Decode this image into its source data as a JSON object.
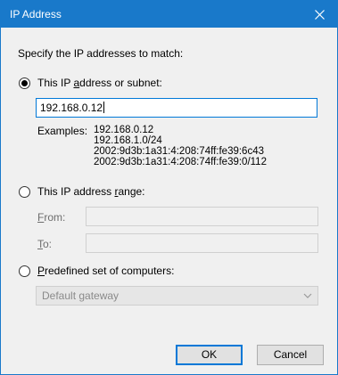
{
  "window": {
    "title": "IP Address"
  },
  "prompt": "Specify the IP addresses to match:",
  "option_subnet": {
    "label_before": "This IP ",
    "label_key": "a",
    "label_after": "ddress or subnet:",
    "selected": true,
    "value": "192.168.0.12"
  },
  "examples": {
    "label": "Examples:",
    "items": [
      "192.168.0.12",
      "192.168.1.0/24",
      "2002:9d3b:1a31:4:208:74ff:fe39:6c43",
      "2002:9d3b:1a31:4:208:74ff:fe39:0/112"
    ]
  },
  "option_range": {
    "label_before": "This IP address ",
    "label_key": "r",
    "label_after": "ange:",
    "selected": false,
    "from_key": "F",
    "from_rest": "rom:",
    "to_key": "T",
    "to_rest": "o:",
    "from_value": "",
    "to_value": ""
  },
  "option_predefined": {
    "label_key": "P",
    "label_after": "redefined set of computers:",
    "selected": false,
    "dropdown_value": "Default gateway"
  },
  "buttons": {
    "ok": "OK",
    "cancel": "Cancel"
  }
}
